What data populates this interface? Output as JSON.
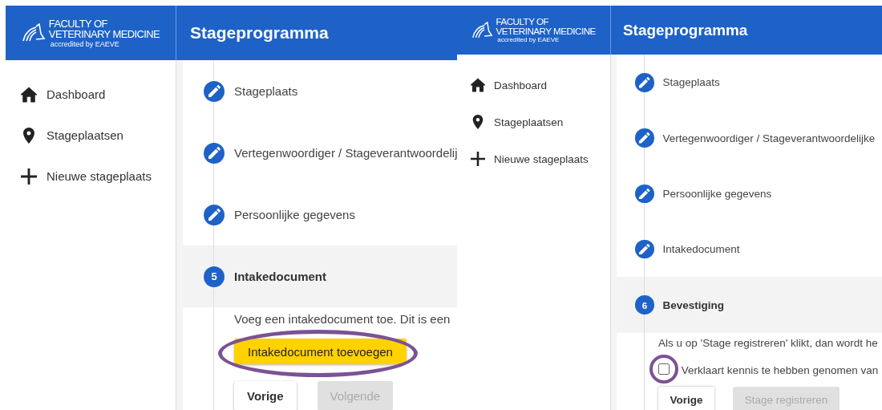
{
  "panels": [
    {
      "logo": {
        "line_1": "FACULTY OF",
        "line_2": "VETERINARY MEDICINE",
        "line_3": "accredited by EAEVE"
      },
      "title": "Stageprogramma",
      "nav": [
        {
          "label": "Dashboard",
          "kind": "home"
        },
        {
          "label": "Stageplaatsen",
          "kind": "pin"
        },
        {
          "label": "Nieuwe stageplaats",
          "kind": "plus"
        }
      ],
      "steps": [
        {
          "label": "Stageplaats",
          "selected": false
        },
        {
          "label": "Vertegenwoordiger / Stageverantwoordelij",
          "selected": false
        },
        {
          "label": "Persoonlijke gegevens",
          "selected": false
        },
        {
          "label": "Intakedocument",
          "selected": true,
          "number": "5"
        }
      ],
      "step_content": {
        "text": "Voeg een intakedocument toe. Dit is een",
        "action_button": {
          "label": "Intakedocument toevoegen",
          "highlighted": true
        },
        "buttons": [
          {
            "label": "Vorige",
            "disabled": false
          },
          {
            "label": "Volgende",
            "disabled": true
          }
        ]
      }
    },
    {
      "logo": {
        "line_1": "FACULTY OF",
        "line_2": "VETERINARY MEDICINE",
        "line_3": "accredited by EAEVE"
      },
      "title": "Stageprogramma",
      "nav": [
        {
          "label": "Dashboard",
          "kind": "home"
        },
        {
          "label": "Stageplaatsen",
          "kind": "pin"
        },
        {
          "label": "Nieuwe stageplaats",
          "kind": "plus"
        }
      ],
      "steps": [
        {
          "label": "Stageplaats",
          "selected": false
        },
        {
          "label": "Vertegenwoordiger / Stageverantwoordelijke",
          "selected": false
        },
        {
          "label": "Persoonlijke gegevens",
          "selected": false
        },
        {
          "label": "Intakedocument",
          "selected": false
        },
        {
          "label": "Bevestiging",
          "selected": true,
          "number": "6"
        }
      ],
      "step_content": {
        "text": "Als u op 'Stage registreren' klikt, dan wordt he",
        "checkbox": {
          "label": "Verklaart kennis te hebben genomen van",
          "checked": false,
          "highlighted": true
        },
        "buttons": [
          {
            "label": "Vorige",
            "disabled": false
          },
          {
            "label": "Stage registreren",
            "disabled": true
          }
        ]
      }
    }
  ]
}
